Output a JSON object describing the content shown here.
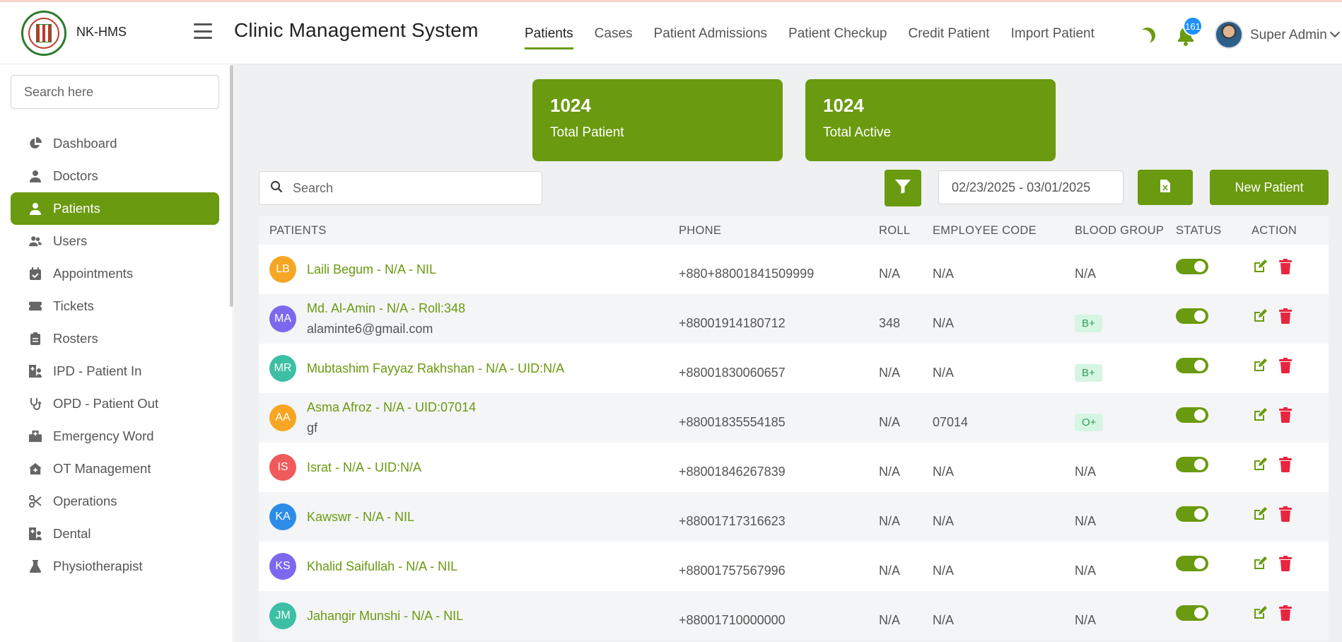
{
  "app": {
    "brand": "NK-HMS",
    "title": "Clinic Management System",
    "accent": "#6a9a0f"
  },
  "topnav": {
    "items": [
      {
        "label": "Patients",
        "active": true
      },
      {
        "label": "Cases"
      },
      {
        "label": "Patient Admissions"
      },
      {
        "label": "Patient Checkup"
      },
      {
        "label": "Credit Patient"
      },
      {
        "label": "Import Patient"
      }
    ],
    "notification_count": "161",
    "user_name": "Super Admin"
  },
  "sidebar": {
    "search_placeholder": "Search here",
    "items": [
      {
        "label": "Dashboard",
        "icon": "pie-chart-icon"
      },
      {
        "label": "Doctors",
        "icon": "doctor-icon"
      },
      {
        "label": "Patients",
        "icon": "patient-icon",
        "active": true
      },
      {
        "label": "Users",
        "icon": "users-icon"
      },
      {
        "label": "Appointments",
        "icon": "calendar-check-icon"
      },
      {
        "label": "Tickets",
        "icon": "ticket-icon"
      },
      {
        "label": "Rosters",
        "icon": "clipboard-icon"
      },
      {
        "label": "IPD - Patient In",
        "icon": "hospital-user-icon"
      },
      {
        "label": "OPD - Patient Out",
        "icon": "stethoscope-icon"
      },
      {
        "label": "Emergency Word",
        "icon": "hospital-icon"
      },
      {
        "label": "OT Management",
        "icon": "clinic-house-icon"
      },
      {
        "label": "Operations",
        "icon": "scissors-icon"
      },
      {
        "label": "Dental",
        "icon": "hospital-user-icon"
      },
      {
        "label": "Physiotherapist",
        "icon": "flask-icon"
      }
    ]
  },
  "stats": {
    "total_patient": {
      "value": "1024",
      "label": "Total Patient"
    },
    "total_active": {
      "value": "1024",
      "label": "Total Active"
    }
  },
  "toolbar": {
    "search_placeholder": "Search",
    "date_range": "02/23/2025 - 03/01/2025",
    "new_patient_label": "New Patient"
  },
  "table": {
    "headers": {
      "patients": "PATIENTS",
      "phone": "PHONE",
      "roll": "ROLL",
      "employee_code": "EMPLOYEE CODE",
      "blood_group": "BLOOD GROUP",
      "status": "STATUS",
      "action": "ACTION"
    },
    "rows": [
      {
        "initials": "LB",
        "color": "#f6a623",
        "name": "Laili Begum - N/A - NIL",
        "email": "",
        "phone": "+880+88001841509999",
        "roll": "N/A",
        "emp": "N/A",
        "blood": "N/A",
        "blood_badge": false
      },
      {
        "initials": "MA",
        "color": "#7b68ee",
        "name": "Md. Al-Amin - N/A - Roll:348",
        "email": "alaminte6@gmail.com",
        "phone": "+88001914180712",
        "roll": "348",
        "emp": "N/A",
        "blood": "B+",
        "blood_badge": true
      },
      {
        "initials": "MR",
        "color": "#3cbfa5",
        "name": "Mubtashim Fayyaz Rakhshan - N/A - UID:N/A",
        "email": "",
        "phone": "+88001830060657",
        "roll": "N/A",
        "emp": "N/A",
        "blood": "B+",
        "blood_badge": true
      },
      {
        "initials": "AA",
        "color": "#f6a623",
        "name": "Asma Afroz - N/A - UID:07014",
        "email": "gf",
        "phone": "+88001835554185",
        "roll": "N/A",
        "emp": "07014",
        "blood": "O+",
        "blood_badge": true
      },
      {
        "initials": "IS",
        "color": "#f05a5a",
        "name": "Israt - N/A - UID:N/A",
        "email": "",
        "phone": "+88001846267839",
        "roll": "N/A",
        "emp": "N/A",
        "blood": "N/A",
        "blood_badge": false
      },
      {
        "initials": "KA",
        "color": "#2d8ce8",
        "name": "Kawswr - N/A - NIL",
        "email": "",
        "phone": "+88001717316623",
        "roll": "N/A",
        "emp": "N/A",
        "blood": "N/A",
        "blood_badge": false
      },
      {
        "initials": "KS",
        "color": "#7b68ee",
        "name": "Khalid Saifullah - N/A - NIL",
        "email": "",
        "phone": "+88001757567996",
        "roll": "N/A",
        "emp": "N/A",
        "blood": "N/A",
        "blood_badge": false
      },
      {
        "initials": "JM",
        "color": "#3cbfa5",
        "name": "Jahangir Munshi - N/A - NIL",
        "email": "",
        "phone": "+88001710000000",
        "roll": "N/A",
        "emp": "N/A",
        "blood": "N/A",
        "blood_badge": false
      }
    ]
  }
}
